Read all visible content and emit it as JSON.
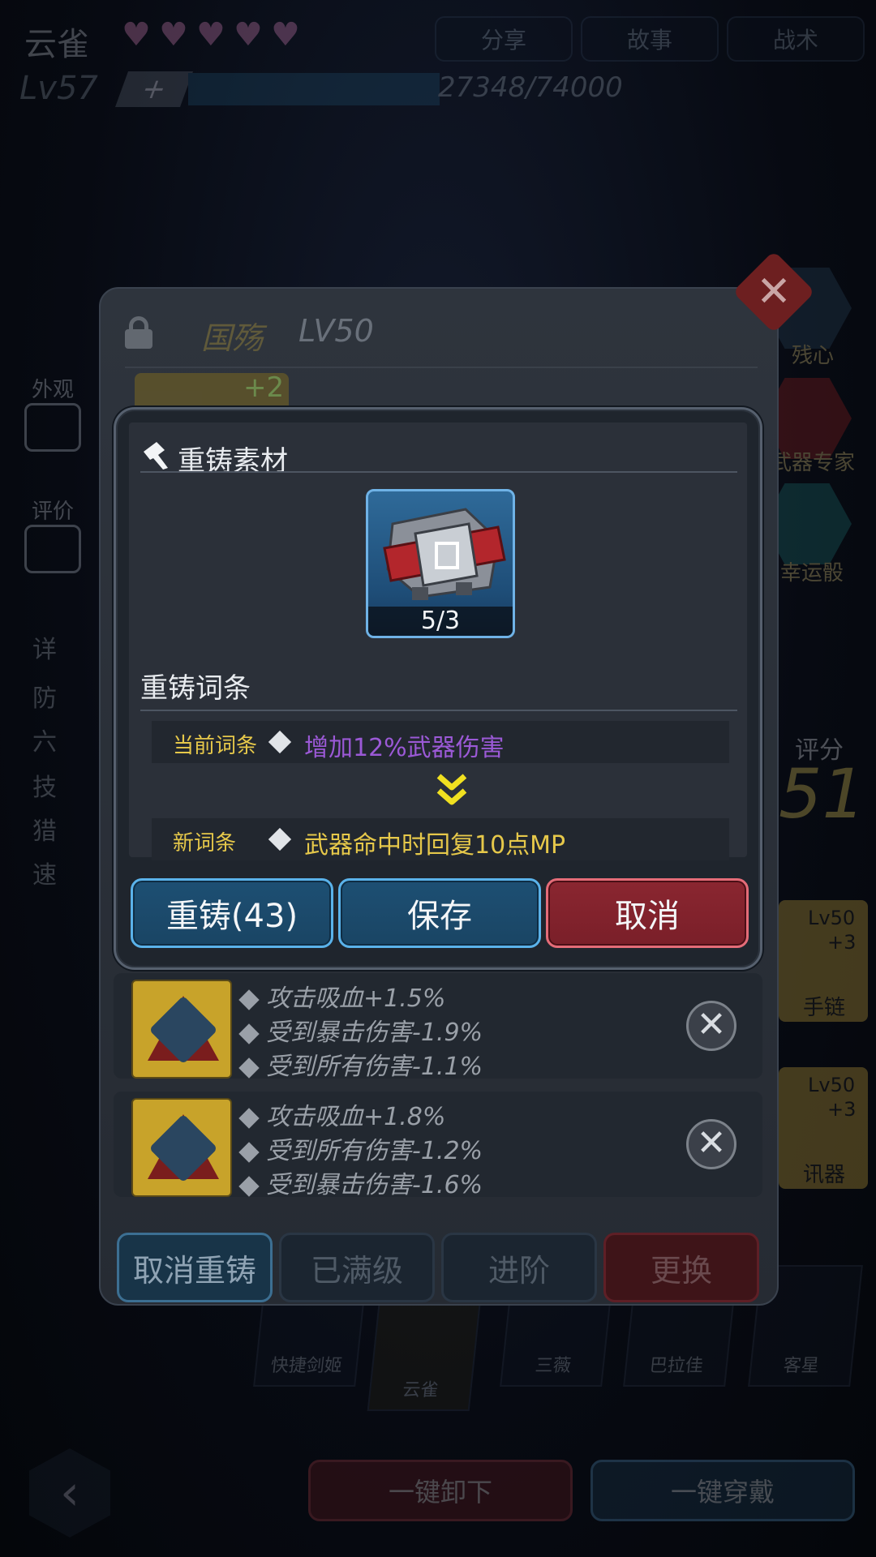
{
  "background": {
    "hero_name": "云雀",
    "level": "Lv57",
    "plus": "+",
    "xp": "27348/74000",
    "tabs": [
      "分享",
      "故事",
      "战术"
    ],
    "left_items": [
      {
        "label": "外观",
        "icon": "shirt-icon"
      },
      {
        "label": "评价",
        "icon": "chat-icon"
      }
    ],
    "right_items": [
      {
        "label": "残心",
        "icon": "skill-hex-icon"
      },
      {
        "label": "武器专家",
        "icon": "weapon-hex-icon"
      },
      {
        "label": "幸运骰",
        "icon": "dice-hex-icon"
      }
    ],
    "score_label": "评分",
    "score_value": "51",
    "left_stats": [
      "详",
      "防",
      "六",
      "技",
      "猎",
      "速"
    ],
    "roster": [
      {
        "name": "快捷剑姬"
      },
      {
        "name": "云雀"
      },
      {
        "name": "三薇"
      },
      {
        "name": "巴拉佳"
      },
      {
        "name": "客星"
      }
    ],
    "right_cards": [
      {
        "top": "Lv50",
        "sub": "+3",
        "name": "手链"
      },
      {
        "top": "Lv50",
        "sub": "+3",
        "name": "讯器"
      }
    ],
    "unequip_all": "一键卸下",
    "equip_all": "一键穿戴",
    "back": "‹"
  },
  "detail": {
    "item_name": "国殇",
    "item_level": "LV50",
    "enhance": "+2",
    "close": "✕",
    "props": [
      {
        "lines": [
          "攻击吸血+1.5%",
          "受到暴击伤害-1.9%",
          "受到所有伤害-1.1%"
        ]
      },
      {
        "lines": [
          "攻击吸血+1.8%",
          "受到所有伤害-1.2%",
          "受到暴击伤害-1.6%"
        ]
      }
    ],
    "remove": "✕",
    "buttons": {
      "cancel_reforge": "取消重铸",
      "maxed": "已满级",
      "advance": "进阶",
      "replace": "更换"
    }
  },
  "modal": {
    "material_title": "重铸素材",
    "material_count": "5/3",
    "entry_title": "重铸词条",
    "current_label": "当前词条",
    "current_text": "增加12%武器伤害",
    "new_label": "新词条",
    "new_text": "武器命中时回复10点MP",
    "reforge_button": "重铸(43)",
    "save_button": "保存",
    "cancel_button": "取消"
  },
  "colors": {
    "current_text": "#9b59d6",
    "new_text": "#e6c84a",
    "arrow": "#f0e020",
    "blue_button": "#1d4f73",
    "red_button": "#8a2630"
  }
}
